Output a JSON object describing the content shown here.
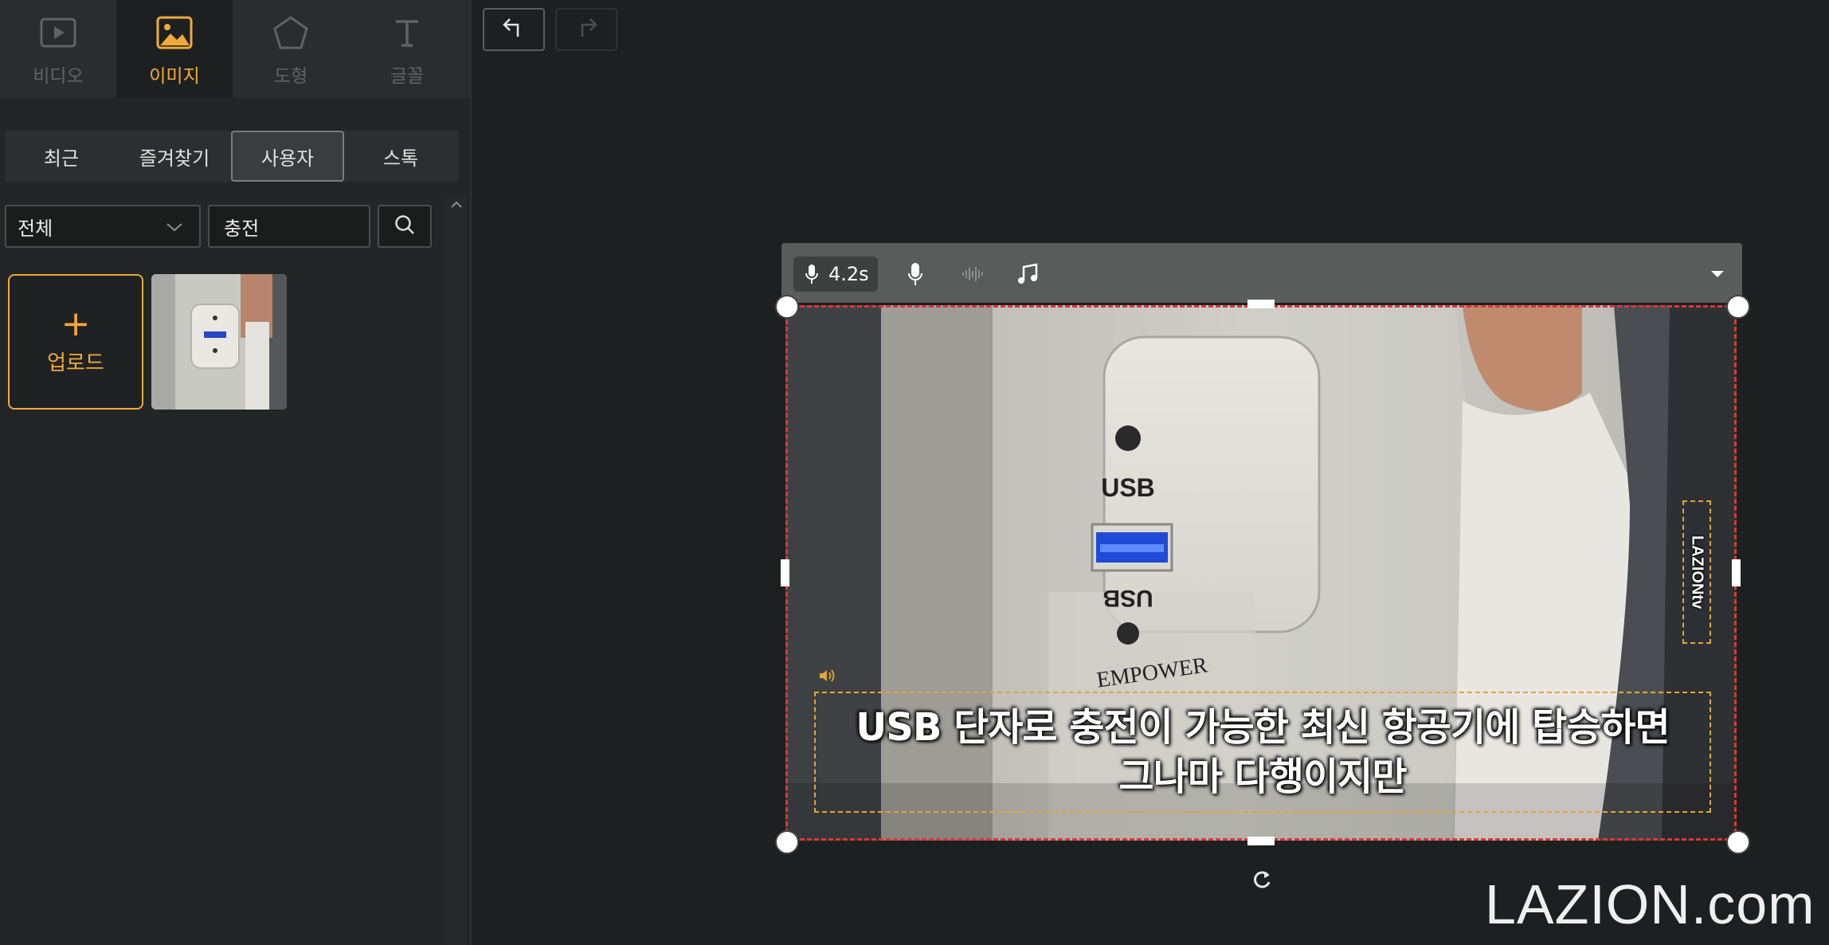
{
  "category_tabs": [
    {
      "label": "비디오",
      "icon": "video-icon"
    },
    {
      "label": "이미지",
      "icon": "image-icon"
    },
    {
      "label": "도형",
      "icon": "pentagon-icon"
    },
    {
      "label": "글꼴",
      "icon": "text-icon"
    }
  ],
  "active_category": "이미지",
  "sub_tabs": [
    "최근",
    "즐겨찾기",
    "사용자",
    "스톡"
  ],
  "active_sub_tab": "사용자",
  "filter": {
    "selected": "전체"
  },
  "search": {
    "value": "충전"
  },
  "upload": {
    "label": "업로드"
  },
  "scene_toolbar": {
    "duration": "4.2s"
  },
  "overlay": {
    "brand_text": "LAZIONtv",
    "caption_line1": "USB 단자로 충전이 가능한 최신 항공기에 탑승하면",
    "caption_line2": "그나마 다행이지만"
  },
  "photo_labels": {
    "usb_top": "USB",
    "usb_bottom": "USB",
    "maker": "EMPOWER"
  },
  "watermark": "LAZION.com",
  "colors": {
    "accent": "#f2a93b",
    "selection": "#e03535",
    "panel": "#232626"
  }
}
